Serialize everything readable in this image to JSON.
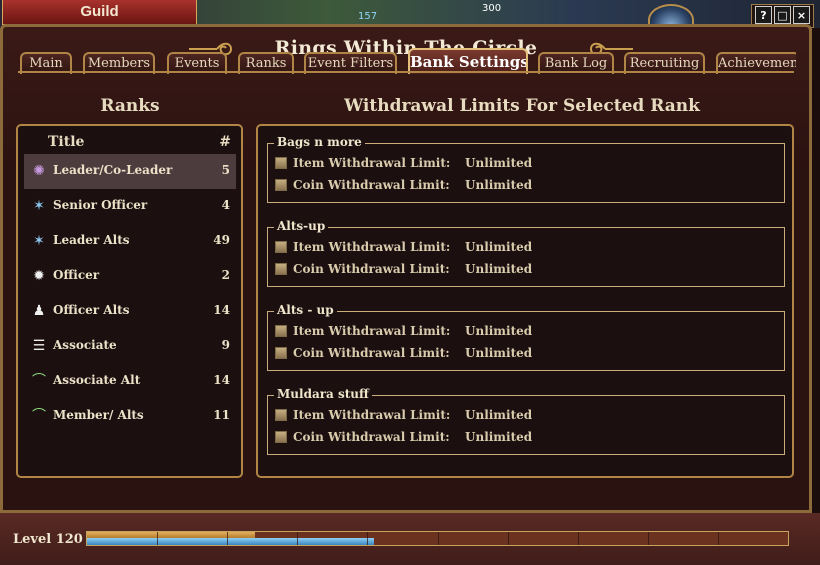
{
  "hud": {
    "numbers": [
      "157",
      "300"
    ]
  },
  "guild_tab": {
    "label": "Guild"
  },
  "window_controls": {
    "help": "?",
    "minimize": "□",
    "close": "×"
  },
  "window": {
    "title": "Rings Within The Circle"
  },
  "tabs": [
    {
      "label": "Main",
      "active": false
    },
    {
      "label": "Members",
      "active": false
    },
    {
      "label": "Events",
      "active": false
    },
    {
      "label": "Ranks",
      "active": false
    },
    {
      "label": "Event Filters",
      "active": false
    },
    {
      "label": "Bank Settings",
      "active": true
    },
    {
      "label": "Bank Log",
      "active": false
    },
    {
      "label": "Recruiting",
      "active": false
    },
    {
      "label": "Achievemen",
      "active": false
    }
  ],
  "ranks_panel": {
    "heading": "Ranks",
    "col_title": "Title",
    "col_count": "#",
    "items": [
      {
        "name": "Leader/Co-Leader",
        "count": "5",
        "icon": "leader-rank-icon",
        "color": "#c79ae0",
        "selected": true
      },
      {
        "name": "Senior Officer",
        "count": "4",
        "icon": "senior-officer-rank-icon",
        "color": "#8ec8ef",
        "selected": false
      },
      {
        "name": "Leader Alts",
        "count": "49",
        "icon": "leader-alts-rank-icon",
        "color": "#8ec8ef",
        "selected": false
      },
      {
        "name": "Officer",
        "count": "2",
        "icon": "officer-rank-icon",
        "color": "#f0f0f0",
        "selected": false
      },
      {
        "name": "Officer Alts",
        "count": "14",
        "icon": "officer-alts-rank-icon",
        "color": "#f0f0f0",
        "selected": false
      },
      {
        "name": "Associate",
        "count": "9",
        "icon": "associate-rank-icon",
        "color": "#f0f0f0",
        "selected": false
      },
      {
        "name": "Associate Alt",
        "count": "14",
        "icon": "associate-alt-rank-icon",
        "color": "#8fe07e",
        "selected": false
      },
      {
        "name": "Member/ Alts",
        "count": "11",
        "icon": "member-alts-rank-icon",
        "color": "#8fe07e",
        "selected": false
      }
    ]
  },
  "limits_panel": {
    "heading": "Withdrawal Limits For Selected Rank",
    "groups": [
      {
        "name": "Bags n more",
        "item_label": "Item Withdrawal Limit:",
        "item_value": "Unlimited",
        "coin_label": "Coin Withdrawal Limit:",
        "coin_value": "Unlimited"
      },
      {
        "name": "Alts-up",
        "item_label": "Item Withdrawal Limit:",
        "item_value": "Unlimited",
        "coin_label": "Coin Withdrawal Limit:",
        "coin_value": "Unlimited"
      },
      {
        "name": "Alts - up",
        "item_label": "Item Withdrawal Limit:",
        "item_value": "Unlimited",
        "coin_label": "Coin Withdrawal Limit:",
        "coin_value": "Unlimited"
      },
      {
        "name": "Muldara stuff",
        "item_label": "Item Withdrawal Limit:",
        "item_value": "Unlimited",
        "coin_label": "Coin Withdrawal Limit:",
        "coin_value": "Unlimited"
      }
    ]
  },
  "level_bar": {
    "label": "Level 120",
    "xp_gold_fraction": 0.24,
    "xp_blue_fraction": 0.41
  },
  "colors": {
    "accent_gold": "#b08546",
    "panel_bg": "#1c0f10",
    "window_bg": "#2a1210"
  }
}
